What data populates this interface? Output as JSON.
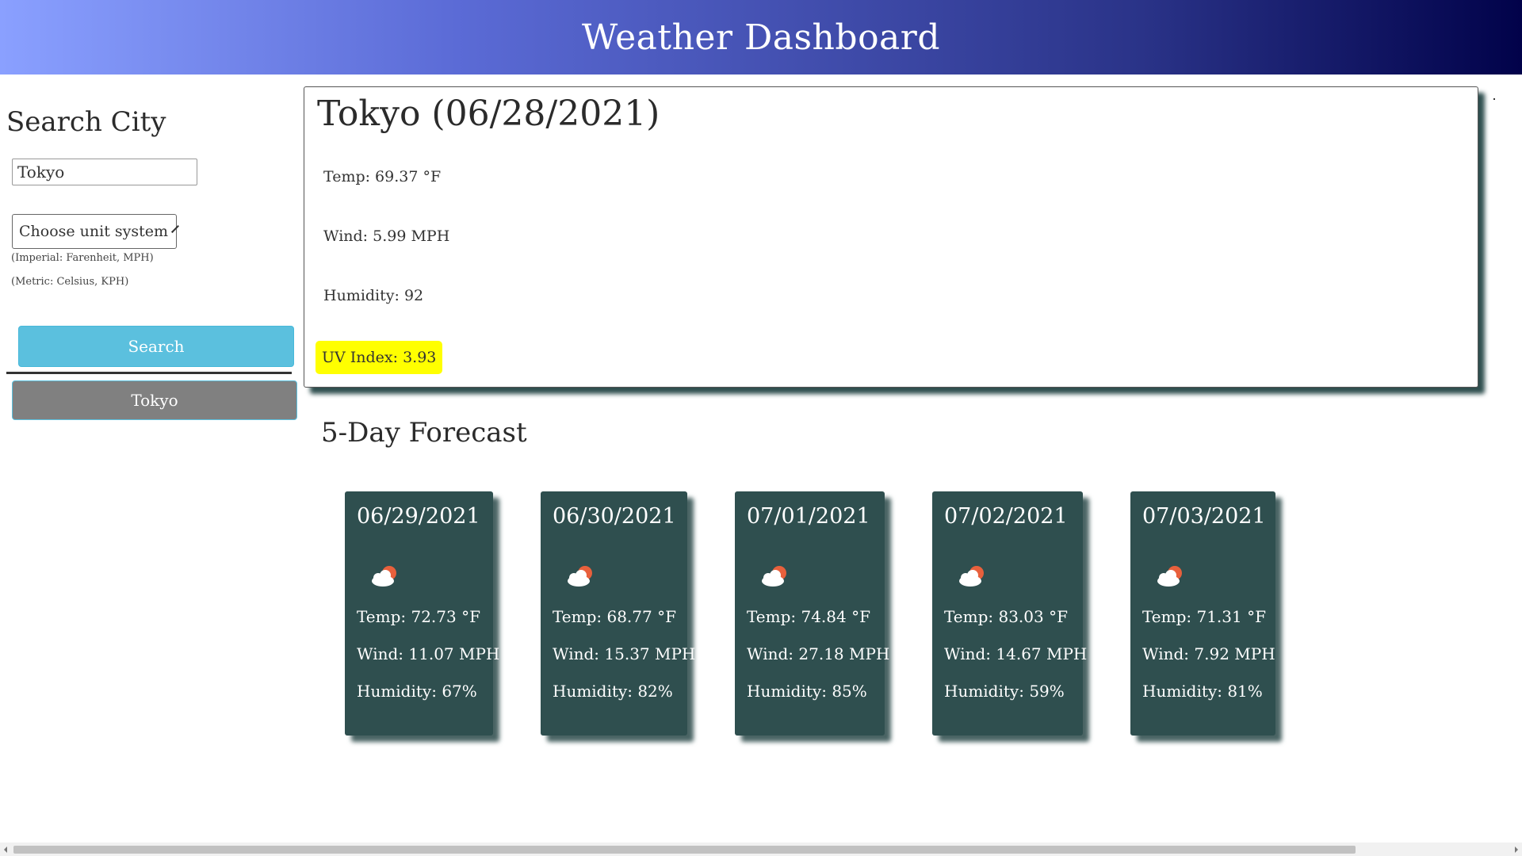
{
  "header": {
    "title": "Weather Dashboard",
    "gradient_colors": [
      "#8aa0ff",
      "#01024a"
    ]
  },
  "sidebar": {
    "title": "Search City",
    "search_input": {
      "value": "Tokyo",
      "placeholder": ""
    },
    "unit_select": {
      "selected": "Choose unit system"
    },
    "notes": [
      "(Imperial: Farenheit, MPH)",
      "(Metric: Celsius, KPH)"
    ],
    "search_button": "Search",
    "history": [
      "Tokyo"
    ]
  },
  "current": {
    "title": "Tokyo (06/28/2021)",
    "temp": "Temp: 69.37 °F",
    "wind": "Wind: 5.99 MPH",
    "humidity": "Humidity: 92",
    "uv": "UV Index: 3.93",
    "uv_color": "#ffff00"
  },
  "forecast": {
    "title": "5-Day Forecast",
    "card_color": "#2f4f4f",
    "days": [
      {
        "date": "06/29/2021",
        "icon": "cloud-sun-icon",
        "temp": "Temp: 72.73 °F",
        "wind": "Wind: 11.07 MPH",
        "humidity": "Humidity: 67%"
      },
      {
        "date": "06/30/2021",
        "icon": "cloud-sun-icon",
        "temp": "Temp: 68.77 °F",
        "wind": "Wind: 15.37 MPH",
        "humidity": "Humidity: 82%"
      },
      {
        "date": "07/01/2021",
        "icon": "cloud-sun-icon",
        "temp": "Temp: 74.84 °F",
        "wind": "Wind: 27.18 MPH",
        "humidity": "Humidity: 85%"
      },
      {
        "date": "07/02/2021",
        "icon": "cloud-sun-icon",
        "temp": "Temp: 83.03 °F",
        "wind": "Wind: 14.67 MPH",
        "humidity": "Humidity: 59%"
      },
      {
        "date": "07/03/2021",
        "icon": "cloud-sun-icon",
        "temp": "Temp: 71.31 °F",
        "wind": "Wind: 7.92 MPH",
        "humidity": "Humidity: 81%"
      }
    ]
  }
}
